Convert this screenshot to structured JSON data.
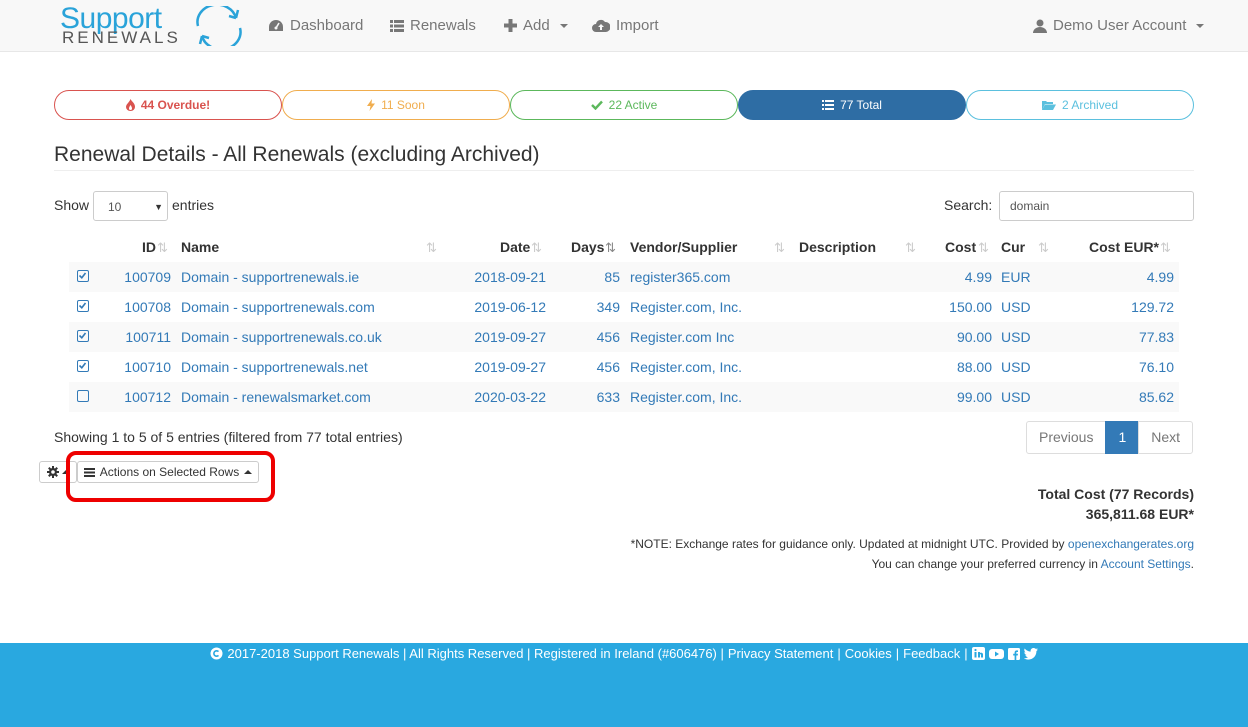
{
  "nav": {
    "logo_top": "Support",
    "logo_bottom": "RENEWALS",
    "dashboard": "Dashboard",
    "renewals": "Renewals",
    "add": "Add",
    "import": "Import",
    "account": "Demo User Account"
  },
  "pills": {
    "overdue": "44 Overdue!",
    "soon": "11 Soon",
    "active": "22 Active",
    "total": "77 Total",
    "archived": "2 Archived"
  },
  "page_title": "Renewal Details - All Renewals (excluding Archived)",
  "controls": {
    "show": "Show",
    "entries_value": "10",
    "entries": "entries",
    "search_label": "Search:",
    "search_value": "domain"
  },
  "table": {
    "columns": [
      "ID",
      "Name",
      "Date",
      "Days",
      "Vendor/Supplier",
      "Description",
      "Cost",
      "Cur",
      "Cost EUR*"
    ],
    "rows": [
      {
        "checked": true,
        "id": "100709",
        "name": "Domain - supportrenewals.ie",
        "date": "2018-09-21",
        "days": "85",
        "vendor": "register365.com",
        "description": "",
        "cost": "4.99",
        "cur": "EUR",
        "cost_eur": "4.99"
      },
      {
        "checked": true,
        "id": "100708",
        "name": "Domain - supportrenewals.com",
        "date": "2019-06-12",
        "days": "349",
        "vendor": "Register.com, Inc.",
        "description": "",
        "cost": "150.00",
        "cur": "USD",
        "cost_eur": "129.72"
      },
      {
        "checked": true,
        "id": "100711",
        "name": "Domain - supportrenewals.co.uk",
        "date": "2019-09-27",
        "days": "456",
        "vendor": "Register.com Inc",
        "description": "",
        "cost": "90.00",
        "cur": "USD",
        "cost_eur": "77.83"
      },
      {
        "checked": true,
        "id": "100710",
        "name": "Domain - supportrenewals.net",
        "date": "2019-09-27",
        "days": "456",
        "vendor": "Register.com, Inc.",
        "description": "",
        "cost": "88.00",
        "cur": "USD",
        "cost_eur": "76.10"
      },
      {
        "checked": false,
        "id": "100712",
        "name": "Domain - renewalsmarket.com",
        "date": "2020-03-22",
        "days": "633",
        "vendor": "Register.com, Inc.",
        "description": "",
        "cost": "99.00",
        "cur": "USD",
        "cost_eur": "85.62"
      }
    ]
  },
  "info": "Showing 1 to 5 of 5 entries (filtered from 77 total entries)",
  "pager": {
    "previous": "Previous",
    "current": "1",
    "next": "Next"
  },
  "actions_label": "Actions on Selected Rows",
  "totals": {
    "label": "Total Cost (77 Records)",
    "value": "365,811.68 EUR*"
  },
  "notes": {
    "note1_text": "*NOTE: Exchange rates for guidance only. Updated at midnight UTC. Provided by ",
    "note1_link": "openexchangerates.org",
    "note2_text": "You can change your preferred currency in ",
    "note2_link": "Account Settings",
    "note2_end": "."
  },
  "footer": {
    "copyright": "2017-2018 Support Renewals | All Rights Reserved | Registered in Ireland (#606476) |",
    "privacy": "Privacy Statement",
    "cookies": "Cookies",
    "feedback": "Feedback",
    "sep": "|"
  },
  "colors": {
    "danger": "#d9534f",
    "warning": "#f0ad4e",
    "success": "#5cb85c",
    "primary": "#2e6da4",
    "info": "#5bc0de",
    "footer": "#29a8e0"
  }
}
